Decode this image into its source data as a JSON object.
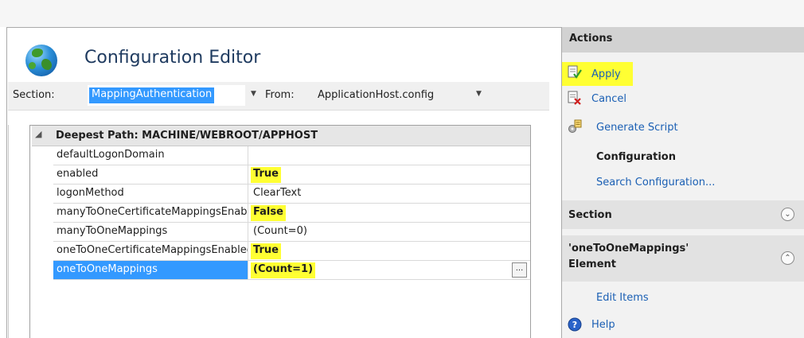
{
  "editor": {
    "title": "Configuration Editor",
    "section_label": "Section:",
    "section_value": "MappingAuthentication",
    "from_label": "From:",
    "from_value": "ApplicationHost.config",
    "grid": {
      "header": "Deepest Path: MACHINE/WEBROOT/APPHOST",
      "rows": [
        {
          "name": "defaultLogonDomain",
          "value": ""
        },
        {
          "name": "enabled",
          "value": "True"
        },
        {
          "name": "logonMethod",
          "value": "ClearText"
        },
        {
          "name": "manyToOneCertificateMappingsEnabled",
          "value": "False"
        },
        {
          "name": "manyToOneMappings",
          "value": "(Count=0)"
        },
        {
          "name": "oneToOneCertificateMappingsEnabled",
          "value": "True"
        },
        {
          "name": "oneToOneMappings",
          "value": "(Count=1)"
        }
      ],
      "ellipsis": "..."
    }
  },
  "actions": {
    "title": "Actions",
    "apply": "Apply",
    "cancel": "Cancel",
    "generate_script": "Generate Script",
    "configuration_heading": "Configuration",
    "search_configuration": "Search Configuration...",
    "section_heading": "Section",
    "element_heading_line1": "'oneToOneMappings'",
    "element_heading_line2": "Element",
    "edit_items": "Edit Items",
    "help": "Help"
  },
  "colors": {
    "highlight": "#ffff33",
    "selection": "#3399ff",
    "link": "#1a5fb4"
  },
  "icons": [
    "globe-icon",
    "apply-icon",
    "cancel-icon",
    "generate-script-icon",
    "help-icon",
    "chevron-down-icon",
    "chevron-up-icon",
    "dropdown-arrow-icon",
    "collapse-icon"
  ]
}
